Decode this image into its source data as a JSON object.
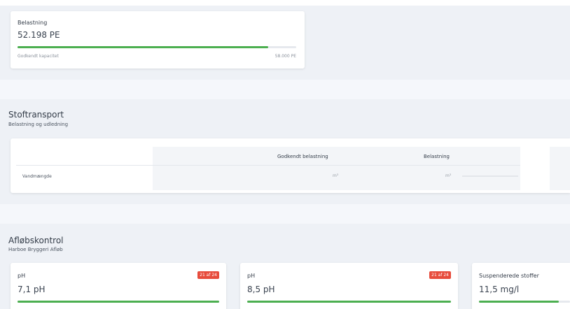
{
  "capacity": {
    "label": "Belastning",
    "value": "52.198 PE",
    "footer_left": "Godkendt kapacitet",
    "footer_right": "58.000 PE",
    "progress": 0.9
  },
  "transport": {
    "title": "Stoftransport",
    "subtitle": "Belastning og udledning",
    "columns": [
      "Godkendt belastning",
      "Belastning"
    ],
    "rows": [
      {
        "label": "Vandmængde",
        "godkendt_unit": "m³",
        "belastning_unit": "m³"
      }
    ]
  },
  "control": {
    "title": "Afløbskontrol",
    "subtitle": "Harboe Bryggeri Afløb",
    "cards": [
      {
        "label": "pH",
        "badge": "21 af 24",
        "value": "7,1 pH",
        "progress": 1.0
      },
      {
        "label": "pH",
        "badge": "21 af 24",
        "value": "8,5 pH",
        "progress": 1.0
      },
      {
        "label": "Suspenderede stoffer",
        "badge": "",
        "value": "11,5 mg/l",
        "progress": 0.88
      }
    ]
  },
  "colors": {
    "progress": "#4caf50",
    "badge": "#e74c3c",
    "band": "#eef1f6"
  }
}
